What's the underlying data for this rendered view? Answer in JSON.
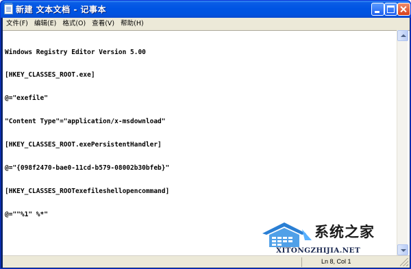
{
  "window": {
    "title": "新建 文本文档 - 记事本"
  },
  "menubar": {
    "items": [
      {
        "label": "文件(F)"
      },
      {
        "label": "编辑(E)"
      },
      {
        "label": "格式(O)"
      },
      {
        "label": "查看(V)"
      },
      {
        "label": "帮助(H)"
      }
    ]
  },
  "editor": {
    "lines": [
      "Windows Registry Editor Version 5.00",
      "[HKEY_CLASSES_ROOT.exe]",
      "@=\"exefile\"",
      "\"Content Type\"=\"application/x-msdownload\"",
      "[HKEY_CLASSES_ROOT.exePersistentHandler]",
      "@=\"{098f2470-bae0-11cd-b579-08002b30bfeb}\"",
      "[HKEY_CLASSES_ROOTexefileshellopencommand]",
      "@=\"\"%1\" %*\""
    ]
  },
  "statusbar": {
    "position": "Ln 8, Col 1"
  },
  "watermark": {
    "brand": "系统之家",
    "url": "XITONGZHIJIA.NET"
  },
  "colors": {
    "titlebar": "#0054e3",
    "menubar": "#ece9d8",
    "watermark_blue": "#2a7fd4"
  },
  "icons": {
    "app": "notepad-icon",
    "minimize": "minimize-icon",
    "maximize": "maximize-icon",
    "close": "close-icon",
    "scroll_up": "arrow-up-icon",
    "scroll_down": "arrow-down-icon"
  }
}
